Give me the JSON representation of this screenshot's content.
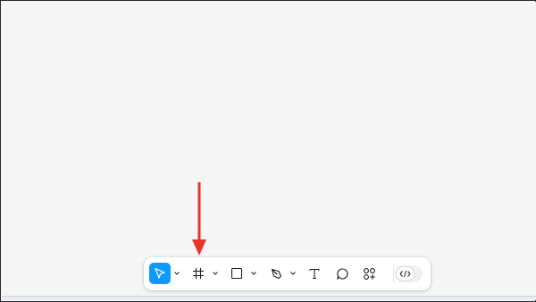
{
  "toolbar": {
    "tools": [
      {
        "name": "move-tool",
        "icon": "cursor-arrow-icon",
        "active": true
      },
      {
        "name": "frame-tool",
        "icon": "hash-frame-icon",
        "active": false
      },
      {
        "name": "shape-tool",
        "icon": "rectangle-icon",
        "active": false
      },
      {
        "name": "pen-tool",
        "icon": "pen-nib-icon",
        "active": false
      },
      {
        "name": "text-tool",
        "icon": "text-t-icon",
        "active": false
      },
      {
        "name": "comment-tool",
        "icon": "speech-bubble-icon",
        "active": false
      },
      {
        "name": "actions-tool",
        "icon": "components-plus-icon",
        "active": false
      }
    ],
    "dev_mode": {
      "icon": "code-brackets-icon",
      "enabled": false
    }
  },
  "annotation": {
    "icon": "red-down-arrow",
    "color": "#e8322a"
  },
  "colors": {
    "accent": "#0d99ff",
    "canvas": "#f5f5f5",
    "icon": "#1e1e1e"
  }
}
